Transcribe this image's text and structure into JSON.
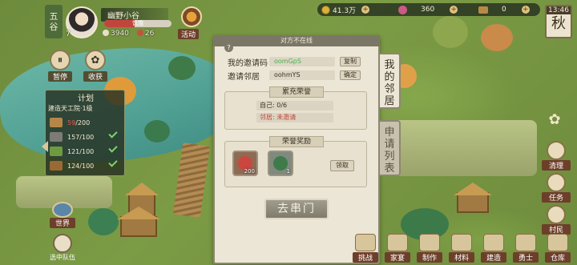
{
  "player": {
    "season_char_top": "五",
    "season_char_bottom": "谷",
    "level": "7",
    "name": "幽野小谷",
    "stamina_text": "饥饿",
    "stamina_fraction": 0.45,
    "resource_a": "3940",
    "resource_b": "26"
  },
  "event": {
    "label": "活动"
  },
  "currency": {
    "coins": "41.3万",
    "jade": "360",
    "tickets": "0"
  },
  "clock": {
    "time": "13:46",
    "season": "秋"
  },
  "left_buttons": [
    {
      "label": "暂停"
    },
    {
      "label": "收获"
    }
  ],
  "plan": {
    "title": "计划",
    "task": "建造天工院·1级",
    "rows": [
      {
        "material": "wood",
        "have": "59",
        "need": "/200",
        "done": false
      },
      {
        "material": "stone",
        "have": "157",
        "need": "/100",
        "done": true
      },
      {
        "material": "herb",
        "have": "121",
        "need": "/100",
        "done": true
      },
      {
        "material": "plank",
        "have": "124",
        "need": "/100",
        "done": true
      }
    ]
  },
  "world_button": {
    "label": "世界"
  },
  "team_button": {
    "label": "选中队伍"
  },
  "modal": {
    "header": "对方不在线",
    "help": "?",
    "my_code_label": "我的邀请码",
    "my_code_value": "oomGpS",
    "copy_label": "复制",
    "neighbor_label": "邀请邻居",
    "neighbor_value": "oohmYS",
    "confirm_label": "确定",
    "honor_title": "累充荣誉",
    "self_stat": "自己: 0/6",
    "neighbor_stat": "邻居: 未邀请",
    "reward_title": "荣誉奖励",
    "reward_1_count": "200",
    "reward_2_count": "1",
    "claim_label": "领取",
    "visit_label": "去串门"
  },
  "side_tabs": [
    {
      "label": "我的邻居"
    },
    {
      "label": "申请列表"
    }
  ],
  "right_buttons": [
    {
      "label": "清理"
    },
    {
      "label": "任务"
    },
    {
      "label": "村民"
    }
  ],
  "bottom_buttons": [
    {
      "label": "挑战"
    },
    {
      "label": "家宴"
    },
    {
      "label": "制作"
    },
    {
      "label": "材料"
    },
    {
      "label": "建造"
    },
    {
      "label": "勇士"
    },
    {
      "label": "仓库"
    }
  ],
  "colors": {
    "modal_bg": "#ece6d6",
    "accent_green": "#4caf50",
    "accent_red": "#c2453d",
    "label_brown": "#6d3f2a"
  }
}
